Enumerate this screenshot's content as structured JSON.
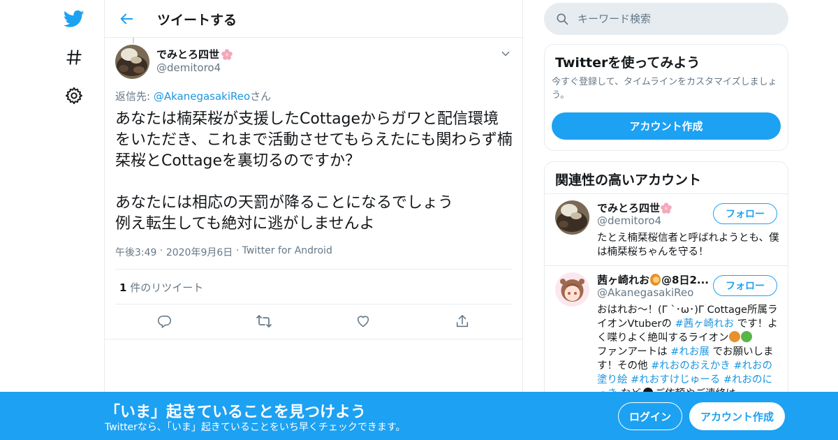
{
  "nav": {
    "items": [
      {
        "icon": "twitter-bird-icon"
      },
      {
        "icon": "hashtag-icon"
      },
      {
        "icon": "gear-icon"
      }
    ]
  },
  "header": {
    "title": "ツイートする"
  },
  "tweet": {
    "display_name": "でみとろ四世",
    "handle": "@demitoro4",
    "reply_prefix": "返信先: ",
    "reply_to": "@AkanegasakiReo",
    "reply_suffix": "さん",
    "body": "あなたは楠栞桜が支援したCottageからガワと配信環境をいただき、これまで活動させてもらえたにも関わらず楠栞桜とCottageを裏切るのですか？\n\nあなたには相応の天罰が降ることになるでしょう\n例え転生しても絶対に逃がしませんよ",
    "time": "午後3:49",
    "date": "2020年9月6日",
    "source": "Twitter for Android",
    "retweet_count": "1",
    "retweet_label": " 件のリツイート"
  },
  "search": {
    "placeholder": "キーワード検索"
  },
  "signup_card": {
    "title": "Twitterを使ってみよう",
    "description": "今すぐ登録して、タイムラインをカスタマイズしましょう。",
    "button": "アカウント作成"
  },
  "related": {
    "title": "関連性の高いアカウント",
    "accounts": [
      {
        "name": "でみとろ四世",
        "handle": "@demitoro4",
        "follow": "フォロー",
        "bio": "たとえ楠栞桜信者と呼ばれようとも、僕は楠栞桜ちゃんを守る！"
      },
      {
        "name": "茜ヶ崎れお",
        "name_suffix": "@8日2...",
        "handle": "@AkanegasakiReo",
        "follow": "フォロー",
        "bio_1": "おはれお〜！(Γ `･ω･)Γ Cottage所属ライオンVtuberの ",
        "tag_1": "#茜ヶ崎れお",
        "bio_2": " です！よく喋りよく絶叫するライオン",
        "bio_3": "ファンアートは ",
        "tag_2": "#れお展",
        "bio_4": " でお願いします！その他 ",
        "tag_3": "#れおのおえかき",
        "tag_4": "#れおの塗り絵",
        "tag_5": "#れおすけじゅーる",
        "tag_6": "#れおのにっき",
        "bio_5": " など",
        "bio_6": "ご依頼やご連絡は"
      }
    ]
  },
  "banner": {
    "title": "「いま」起きていることを見つけよう",
    "subtitle": "Twitterなら、「いま」起きていることをいち早くチェックできます。",
    "login": "ログイン",
    "signup": "アカウント作成"
  },
  "colors": {
    "accent": "#1da1f2",
    "link": "#1b95e0",
    "muted": "#657786",
    "border": "#e6ecf0"
  }
}
